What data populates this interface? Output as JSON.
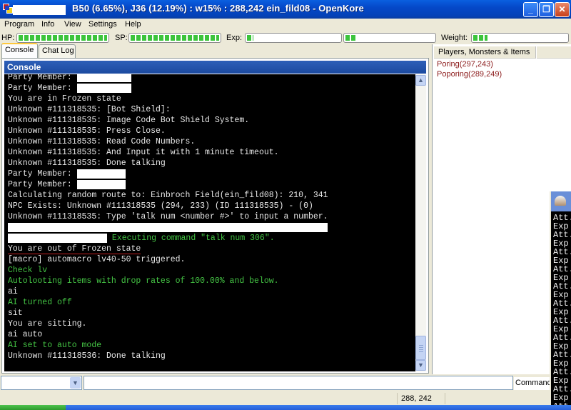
{
  "window": {
    "title": "B50 (6.65%), J36 (12.19%) : w15% : 288,242 ein_fild08 - OpenKore",
    "minimize_label": "_",
    "restore_label": "❐",
    "close_label": "✕"
  },
  "menu": {
    "items": [
      {
        "label": "Program"
      },
      {
        "label": "Info"
      },
      {
        "label": "View"
      },
      {
        "label": "Settings"
      },
      {
        "label": "Help"
      }
    ]
  },
  "stats": {
    "hp_label": "HP:",
    "hp_percent": 100,
    "sp_label": "SP:",
    "sp_percent": 100,
    "exp_label": "Exp:",
    "base_exp_percent": 6.65,
    "job_exp_percent": 12.19,
    "weight_label": "Weight:",
    "weight_percent": 15
  },
  "tabs": [
    {
      "label": "Console",
      "active": true
    },
    {
      "label": "Chat Log",
      "active": false
    }
  ],
  "console": {
    "header": "Console",
    "lines": [
      {
        "text": "Party Member: ",
        "color": "white",
        "redacted": true
      },
      {
        "text": "Party Member: ",
        "color": "white",
        "redacted": true
      },
      {
        "text": "You are in Frozen state",
        "color": "white"
      },
      {
        "text": "Unknown #111318535: [Bot Shield]:",
        "color": "white"
      },
      {
        "text": "Unknown #111318535: Image Code Bot Shield System.",
        "color": "white"
      },
      {
        "text": "Unknown #111318535: Press Close.",
        "color": "white"
      },
      {
        "text": "Unknown #111318535: Read Code Numbers.",
        "color": "white"
      },
      {
        "text": "Unknown #111318535: And Input it with 1 minute timeout.",
        "color": "white"
      },
      {
        "text": "Unknown #111318535: Done talking",
        "color": "white"
      },
      {
        "text": "Party Member: ",
        "color": "white",
        "redacted": true
      },
      {
        "text": "Party Member: ",
        "color": "white",
        "redacted": true
      },
      {
        "text": "Calculating random route to: Einbroch Field(ein_fild08): 210, 341",
        "color": "white"
      },
      {
        "text": "NPC Exists: Unknown #111318535 (294, 233) (ID 111318535) - (0)",
        "color": "white"
      },
      {
        "text": "Unknown #111318535: Type 'talk num <number #>' to input a number.",
        "color": "white"
      },
      {
        "text": "",
        "color": "white",
        "redacted": true
      },
      {
        "text": " Executing command \"talk num 306\".",
        "color": "green",
        "redacted": true
      },
      {
        "text": "You are out of Frozen state",
        "color": "white"
      },
      {
        "text": "[macro] automacro lv40-50 triggered.",
        "color": "white"
      },
      {
        "text": "Check lv",
        "color": "green"
      },
      {
        "text": "Autolooting items with drop rates of 100.00% and below.",
        "color": "green"
      },
      {
        "text": "ai",
        "color": "white"
      },
      {
        "text": "AI turned off",
        "color": "green"
      },
      {
        "text": "sit",
        "color": "white"
      },
      {
        "text": "You are sitting.",
        "color": "white"
      },
      {
        "text": "ai auto",
        "color": "white"
      },
      {
        "text": "AI set to auto mode",
        "color": "green"
      },
      {
        "text": "Unknown #111318536: Done talking",
        "color": "white"
      }
    ]
  },
  "right_panel": {
    "header": "Players, Monsters & Items",
    "items": [
      {
        "label": "Poring(297,243)"
      },
      {
        "label": "Poporing(289,249)"
      }
    ]
  },
  "overlay_window": {
    "lines": [
      "Att.",
      "Exp",
      "Att.",
      "Exp",
      "Att.",
      "Exp",
      "Att.",
      "Exp",
      "Att.",
      "Exp",
      "Att.",
      "Exp",
      "Att.",
      "Exp",
      "Att.",
      "Exp",
      "Att.",
      "Exp",
      "Att.",
      "Exp",
      "Att.",
      "Exp",
      "Att."
    ]
  },
  "input": {
    "combo_value": "",
    "command_value": "",
    "command_label": "Command"
  },
  "statusbar": {
    "coords": "288, 242"
  },
  "colors": {
    "console_white": "#e8e8e8",
    "console_green": "#44c444",
    "monster_text": "#8b1a1a",
    "gauge_fill": "#3cc43c"
  }
}
